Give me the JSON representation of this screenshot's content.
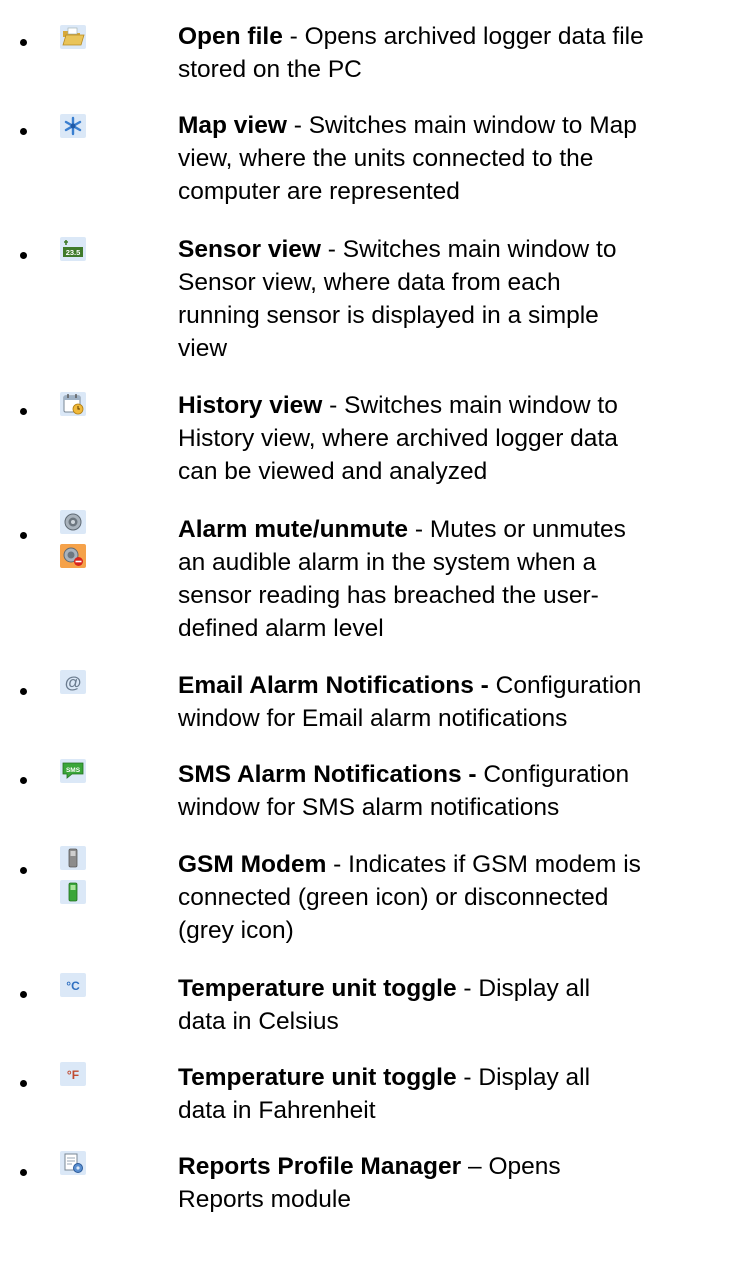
{
  "items": [
    {
      "title": "Open file",
      "sep": " - ",
      "l1": "Opens archived logger data file",
      "l2": "stored on the PC",
      "l3": "",
      "l4": "",
      "icons": [
        "open-folder-icon"
      ]
    },
    {
      "title": "Map view",
      "sep": " - ",
      "l1": "Switches main window to Map",
      "l2": "view, where the units connected to the",
      "l3": "computer are represented",
      "l4": "",
      "icons": [
        "map-star-icon"
      ]
    },
    {
      "title": "Sensor view",
      "sep": " - ",
      "l1": "Switches main window to",
      "l2": "Sensor view, where data from each",
      "l3": "running sensor is displayed in a simple",
      "l4": "view",
      "icons": [
        "sensor-reading-icon"
      ]
    },
    {
      "title": "History view",
      "sep": " - ",
      "l1": "Switches main window to",
      "l2": "History view, where archived logger data",
      "l3": "can be viewed and analyzed",
      "l4": "",
      "icons": [
        "calendar-clock-icon"
      ]
    },
    {
      "title": "Alarm mute/unmute",
      "sep": " - ",
      "l1": "Mutes or unmutes",
      "l2": "an audible alarm in the system when a",
      "l3": "sensor reading has breached the user-",
      "l4": "defined alarm level",
      "icons": [
        "alarm-speaker-icon",
        "alarm-muted-icon"
      ]
    },
    {
      "title": "Email Alarm Notifications -",
      "sep": " ",
      "l1": "Configuration",
      "l2": "window for Email alarm notifications",
      "l3": "",
      "l4": "",
      "icons": [
        "email-at-icon"
      ]
    },
    {
      "title": "SMS Alarm Notifications -",
      "sep": " ",
      "l1": "Configuration",
      "l2": "window for SMS alarm notifications",
      "l3": "",
      "l4": "",
      "icons": [
        "sms-bubble-icon"
      ]
    },
    {
      "title": "GSM Modem",
      "sep": " - ",
      "l1": "Indicates if GSM modem is",
      "l2": "connected (green icon) or disconnected",
      "l3": "(grey icon)",
      "l4": "",
      "icons": [
        "gsm-modem-grey-icon",
        "gsm-modem-green-icon"
      ]
    },
    {
      "title": "Temperature unit toggle",
      "sep": " - ",
      "l1": "Display all",
      "l2": "data in Celsius",
      "l3": "",
      "l4": "",
      "icons": [
        "celsius-icon"
      ]
    },
    {
      "title": "Temperature unit toggle",
      "sep": " - ",
      "l1": "Display all",
      "l2": "data in Fahrenheit",
      "l3": "",
      "l4": "",
      "icons": [
        "fahrenheit-icon"
      ]
    },
    {
      "title": "Reports Profile Manager",
      "sep": " – ",
      "l1": "Opens",
      "l2": "Reports module",
      "l3": "",
      "l4": "",
      "icons": [
        "reports-gear-icon"
      ]
    }
  ],
  "icon_glyphs": {
    "sensor": "23.5",
    "email": "@",
    "sms": "SMS",
    "celsius": "°C",
    "fahrenheit": "°F"
  },
  "colors": {
    "icon_tile": "#dbe8f7",
    "folder": "#e9c45a",
    "green": "#3aa63a",
    "grey": "#8c8c8c",
    "mute_tile": "#f5a24a",
    "mute_stop": "#d9251c",
    "star": "#3a7fd0",
    "unit_blue": "#2f6fc0"
  }
}
